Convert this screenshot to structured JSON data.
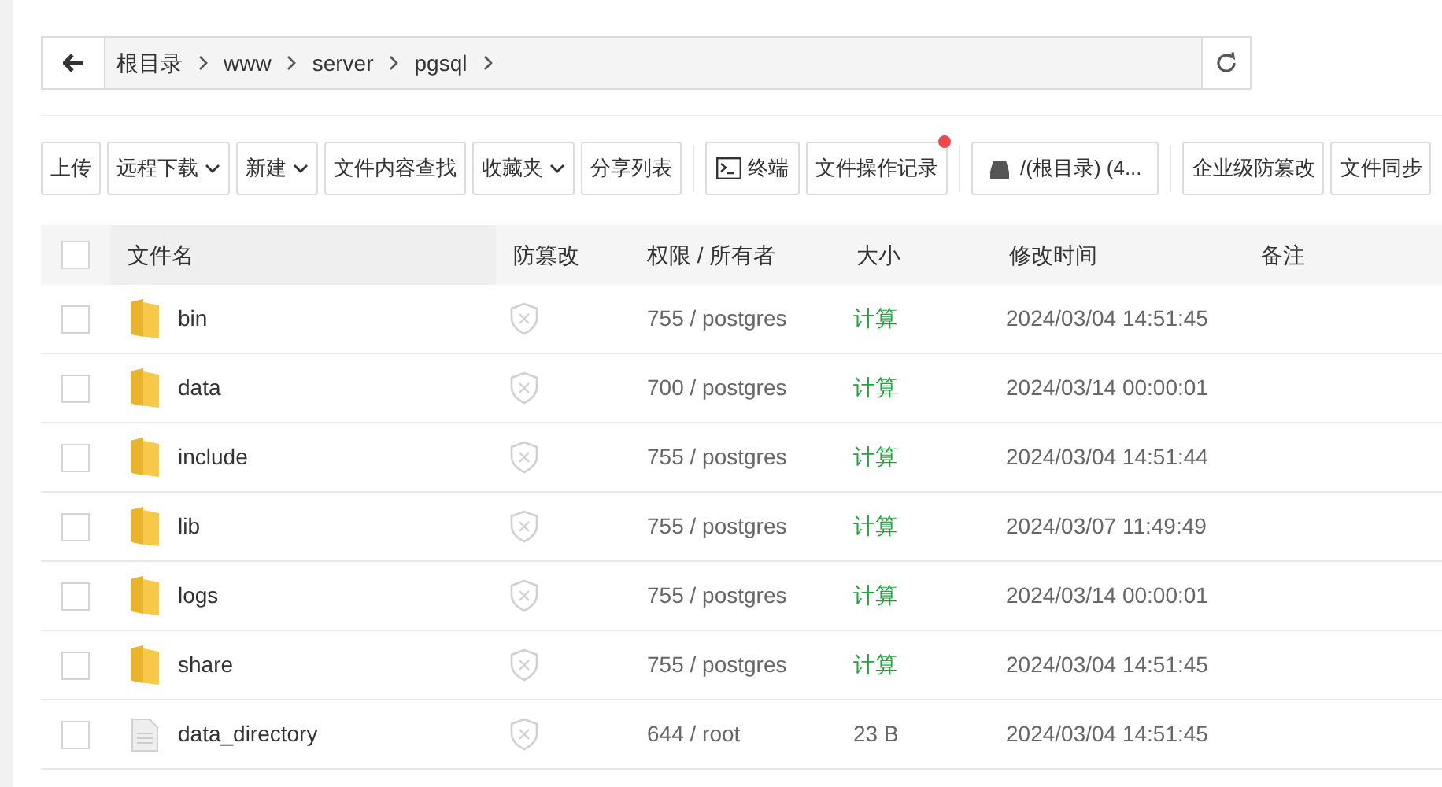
{
  "breadcrumb": [
    "根目录",
    "www",
    "server",
    "pgsql"
  ],
  "toolbar": [
    [
      {
        "label": "上传",
        "kind": "plain"
      },
      {
        "label": "远程下载",
        "kind": "dropdown"
      },
      {
        "label": "新建",
        "kind": "dropdown"
      },
      {
        "label": "文件内容查找",
        "kind": "plain"
      },
      {
        "label": "收藏夹",
        "kind": "dropdown"
      },
      {
        "label": "分享列表",
        "kind": "plain"
      }
    ],
    [
      {
        "label": "终端",
        "kind": "terminal"
      },
      {
        "label": "文件操作记录",
        "kind": "plain",
        "notification": true
      }
    ],
    [
      {
        "label": "/(根目录) (4...",
        "kind": "disk"
      }
    ],
    [
      {
        "label": "企业级防篡改",
        "kind": "plain"
      },
      {
        "label": "文件同步",
        "kind": "plain"
      }
    ]
  ],
  "table": {
    "select_all_checked": false,
    "columns": [
      "文件名",
      "防篡改",
      "权限 / 所有者",
      "大小",
      "修改时间",
      "备注"
    ],
    "rows": [
      {
        "checked": false,
        "kind": "folder",
        "name": "bin",
        "permission": "755 / postgres",
        "size": {
          "text": "计算",
          "kind": "link"
        },
        "modified": "2024/03/04 14:51:45"
      },
      {
        "checked": false,
        "kind": "folder",
        "name": "data",
        "permission": "700 / postgres",
        "size": {
          "text": "计算",
          "kind": "link"
        },
        "modified": "2024/03/14 00:00:01"
      },
      {
        "checked": false,
        "kind": "folder",
        "name": "include",
        "permission": "755 / postgres",
        "size": {
          "text": "计算",
          "kind": "link"
        },
        "modified": "2024/03/04 14:51:44"
      },
      {
        "checked": false,
        "kind": "folder",
        "name": "lib",
        "permission": "755 / postgres",
        "size": {
          "text": "计算",
          "kind": "link"
        },
        "modified": "2024/03/07 11:49:49"
      },
      {
        "checked": false,
        "kind": "folder",
        "name": "logs",
        "permission": "755 / postgres",
        "size": {
          "text": "计算",
          "kind": "link"
        },
        "modified": "2024/03/14 00:00:01"
      },
      {
        "checked": false,
        "kind": "folder",
        "name": "share",
        "permission": "755 / postgres",
        "size": {
          "text": "计算",
          "kind": "link"
        },
        "modified": "2024/03/04 14:51:45"
      },
      {
        "checked": false,
        "kind": "file",
        "name": "data_directory",
        "permission": "644 / root",
        "size": {
          "text": "23 B",
          "kind": "plain"
        },
        "modified": "2024/03/04 14:51:45"
      }
    ]
  }
}
